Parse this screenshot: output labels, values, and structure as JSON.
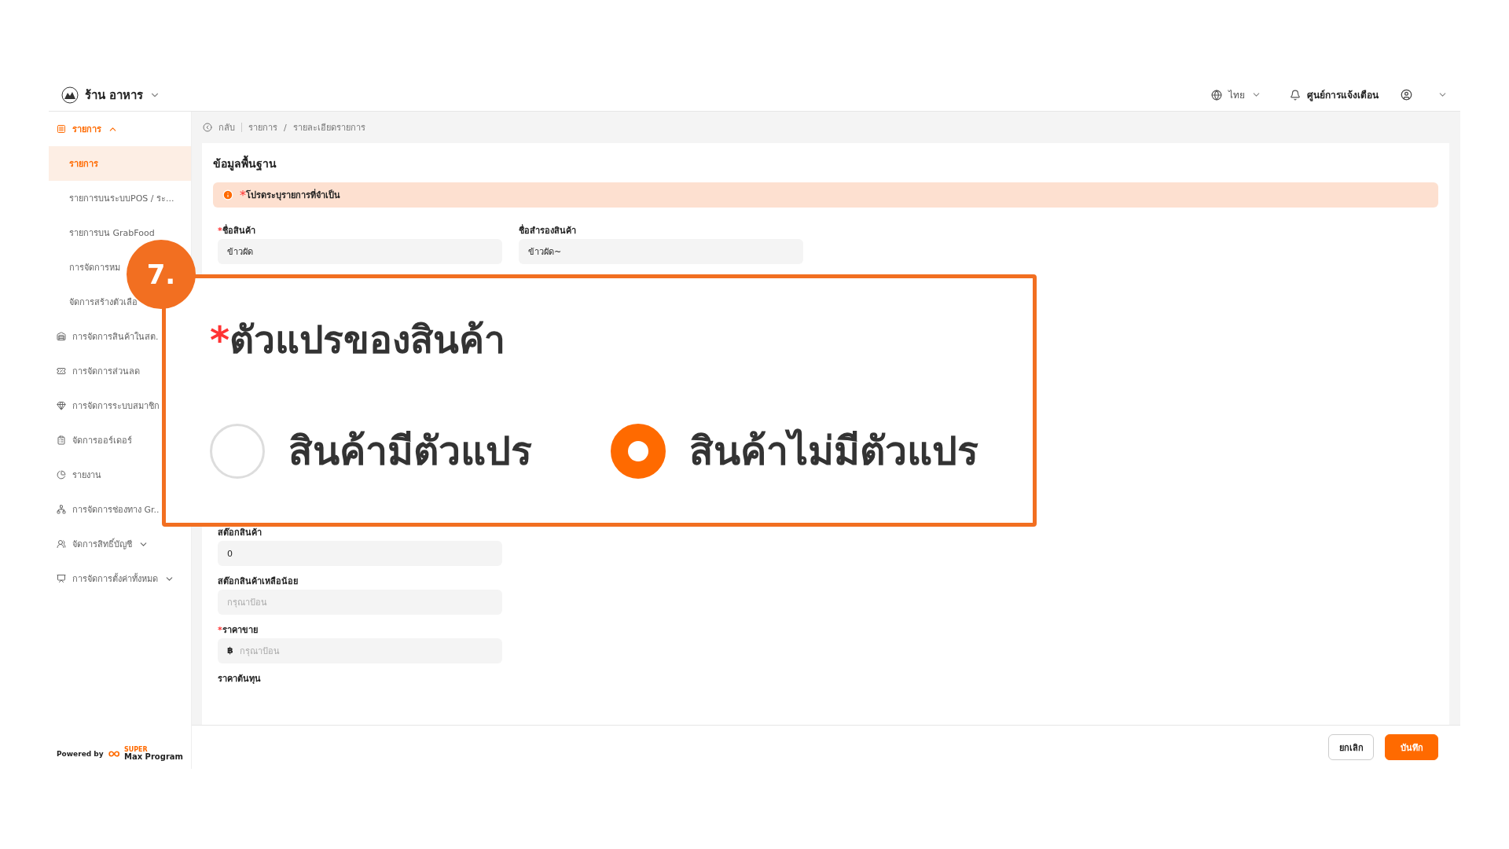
{
  "header": {
    "store_name": "ร้าน อาหาร",
    "language": "ไทย",
    "notifications": "ศูนย์การแจ้งเตือน"
  },
  "sidebar": {
    "items": [
      {
        "label": "รายการ",
        "expanded": true,
        "selected": true,
        "children": [
          {
            "label": "รายการ",
            "selected": true
          },
          {
            "label": "รายการบนระบบPOS / ระ...",
            "selected": false
          },
          {
            "label": "รายการบน GrabFood",
            "selected": false
          },
          {
            "label": "การจัดการหม",
            "selected": false
          },
          {
            "label": "จัดการสร้างตัวเลือ",
            "selected": false
          }
        ]
      },
      {
        "label": "การจัดการสินค้าในสต.",
        "selected": false
      },
      {
        "label": "การจัดการส่วนลด",
        "selected": false
      },
      {
        "label": "การจัดการระบบสมาชิก",
        "selected": false
      },
      {
        "label": "จัดการออร์เดอร์",
        "selected": false
      },
      {
        "label": "รายงาน",
        "selected": false
      },
      {
        "label": "การจัดการช่องทาง Gr..",
        "selected": false
      },
      {
        "label": "จัดการสิทธิ์บัญชี",
        "expanded": false,
        "selected": false
      },
      {
        "label": "การจัดการตั้งค่าทั้งหมด",
        "expanded": false,
        "selected": false
      }
    ],
    "powered_by": "Powered by",
    "brand_small": "SUPER",
    "brand": "Max Program"
  },
  "breadcrumb": {
    "back": "กลับ",
    "separator": "/",
    "path": [
      "รายการ",
      "รายละเอียดรายการ"
    ]
  },
  "card": {
    "title": "ข้อมูลพื้นฐาน",
    "alert_marker": "*",
    "alert": "โปรดระบุรายการที่จำเป็น",
    "top_fields": [
      {
        "label": "ชื่อสินค้า",
        "required": true,
        "value": "ข้าวผัด"
      },
      {
        "label": "ชื่อสำรองสินค้า",
        "required": false,
        "value": "ข้าวผัด~"
      }
    ],
    "fields": [
      {
        "label": "สต๊อกสินค้า",
        "required": false,
        "value": "0"
      },
      {
        "label": "สต๊อกสินค้าเหลือน้อย",
        "required": false,
        "placeholder": "กรุณาป้อน"
      },
      {
        "label": "ราคาขาย",
        "required": true,
        "prefix": "฿",
        "placeholder": "กรุณาป้อน"
      },
      {
        "label": "ราคาต้นทุน",
        "required": false
      }
    ]
  },
  "callout": {
    "badge": "7.",
    "title": "ตัวแปรของสินค้า",
    "required": true,
    "options": [
      {
        "label": "สินค้ามีตัวแปร",
        "selected": false
      },
      {
        "label": "สินค้าไม่มีตัวแปร",
        "selected": true
      }
    ]
  },
  "actions": {
    "cancel": "ยกเลิก",
    "save": "บันทึก"
  }
}
